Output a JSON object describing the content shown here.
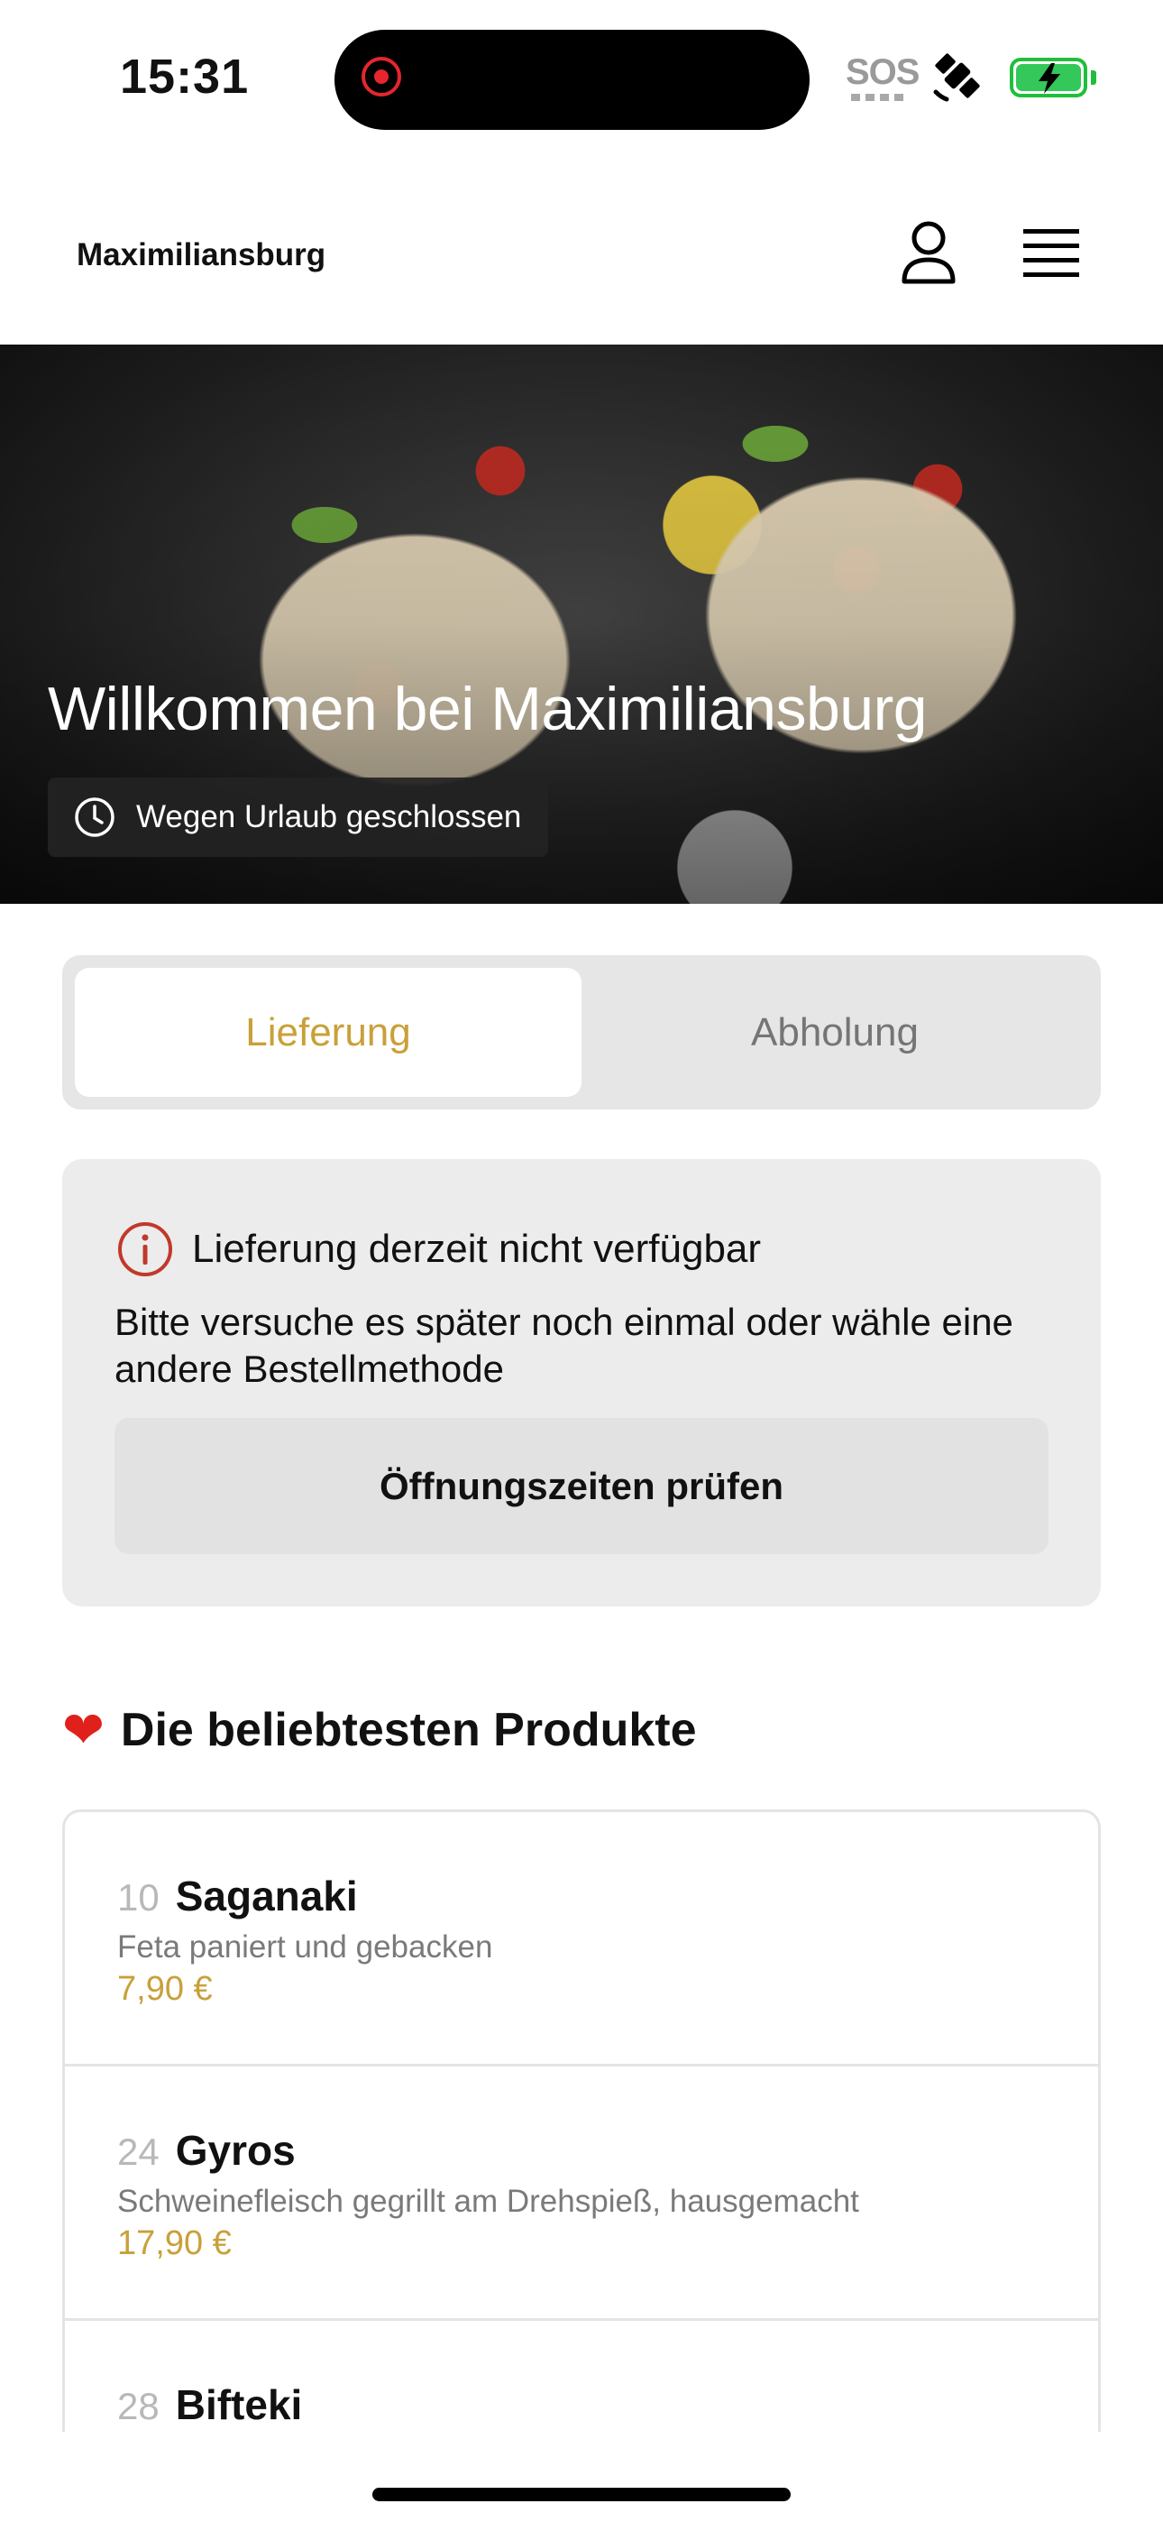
{
  "status_bar": {
    "time": "15:31",
    "sos": "SOS"
  },
  "header": {
    "restaurant_name": "Maximiliansburg"
  },
  "hero": {
    "title": "Willkommen bei Maximiliansburg",
    "status_badge": "Wegen Urlaub geschlossen"
  },
  "tabs": [
    {
      "label": "Lieferung",
      "active": true
    },
    {
      "label": "Abholung",
      "active": false
    }
  ],
  "notice": {
    "title": "Lieferung derzeit nicht verfügbar",
    "message": "Bitte versuche es später noch einmal oder wähle eine andere Bestellmethode",
    "button_label": "Öffnungszeiten prüfen"
  },
  "popular": {
    "heading": "Die beliebtesten Produkte",
    "products": [
      {
        "number": "10",
        "name": "Saganaki",
        "description": "Feta paniert und gebacken",
        "price": "7,90 €"
      },
      {
        "number": "24",
        "name": "Gyros",
        "description": "Schweinefleisch gegrillt am Drehspieß, hausgemacht",
        "price": "17,90 €"
      },
      {
        "number": "28",
        "name": "Bifteki",
        "description": "",
        "price": ""
      }
    ]
  },
  "colors": {
    "accent_gold": "#c9a03a",
    "alert_red": "#c0392b"
  }
}
